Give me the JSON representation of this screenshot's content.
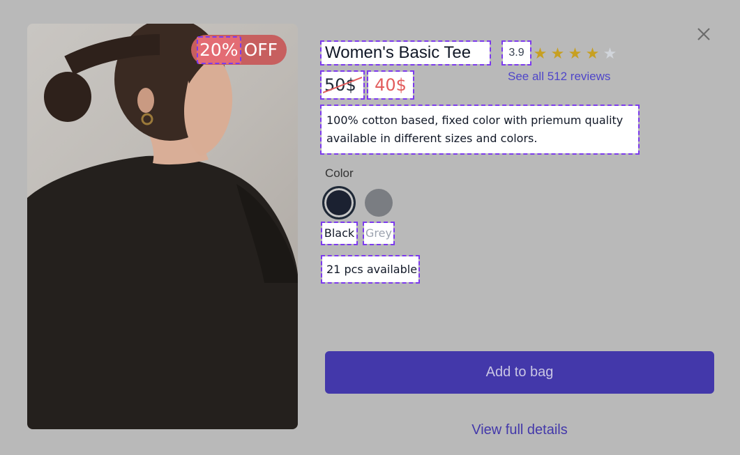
{
  "product": {
    "image_alt": "woman wearing black t-shirt, back view",
    "discount_percent": "20%",
    "discount_word": "OFF",
    "title": "Women's Basic Tee",
    "rating": "3.9",
    "rating_value": 3.9,
    "stars_filled": 4,
    "stars_total": 5,
    "reviews_link": "See all 512 reviews",
    "old_price": "50$",
    "new_price": "40$",
    "description": "100% cotton based, fixed color with priemum quality available in different sizes and colors.",
    "color_label": "Color",
    "colors": [
      {
        "name": "Black",
        "hex": "#1b2131",
        "selected": true
      },
      {
        "name": "Grey",
        "hex": "#7a7d82",
        "selected": false
      }
    ],
    "stock": "21 pcs available"
  },
  "actions": {
    "add_to_bag": "Add to bag",
    "view_details": "View full details"
  },
  "icons": {
    "close": "close-icon",
    "star": "star-icon"
  },
  "colors": {
    "accent": "#4338aa",
    "sale_red": "#e25c5c",
    "star_gold": "#c7a022",
    "outline_dash": "#7c3aed"
  }
}
